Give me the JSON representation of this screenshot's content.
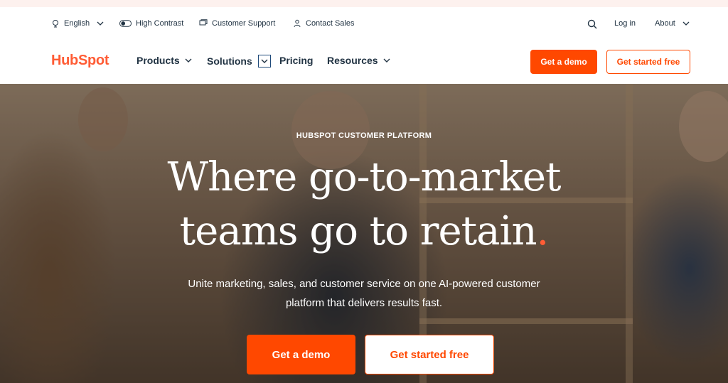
{
  "utility": {
    "language": "English",
    "contrast": "High Contrast",
    "support": "Customer Support",
    "sales": "Contact Sales",
    "login": "Log in",
    "about": "About"
  },
  "nav": {
    "logo": "HubSpot",
    "items": [
      "Products",
      "Solutions",
      "Pricing",
      "Resources"
    ],
    "demo_button": "Get a demo",
    "start_button": "Get started free"
  },
  "hero": {
    "eyebrow": "HUBSPOT CUSTOMER PLATFORM",
    "headline_line1": "Where go-to-market",
    "headline_line2": "teams go to retain",
    "headline_dot": ".",
    "subtext": "Unite marketing, sales, and customer service on one AI-powered customer platform that delivers results fast.",
    "demo_button": "Get a demo",
    "start_button": "Get started free"
  },
  "colors": {
    "accent": "#ff4800",
    "logo": "#ff5c35",
    "text": "#213343"
  },
  "icons": [
    "globe-icon",
    "contrast-toggle-icon",
    "chat-icon",
    "person-icon",
    "search-icon",
    "chevron-down-icon"
  ]
}
